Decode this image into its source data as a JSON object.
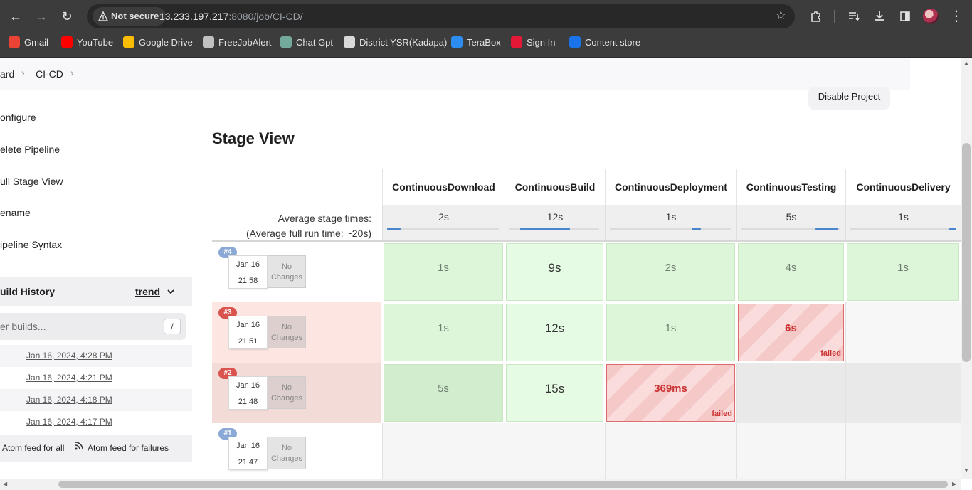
{
  "browser": {
    "back": "←",
    "forward": "→",
    "reload": "↻",
    "security_label": "Not secure",
    "url_host": "13.233.197.217",
    "url_rest": ":8080/job/CI-CD/",
    "star": "☆",
    "menu": "⋮"
  },
  "bookmarks": [
    {
      "label": "Gmail",
      "color": "#ea4335"
    },
    {
      "label": "YouTube",
      "color": "#ff0000"
    },
    {
      "label": "Google Drive",
      "color": "#fbbc04"
    },
    {
      "label": "FreeJobAlert",
      "color": "#c0c0c0"
    },
    {
      "label": "Chat Gpt",
      "color": "#74aa9c"
    },
    {
      "label": "District YSR(Kadapa)",
      "color": "#d9d9d9"
    },
    {
      "label": "TeraBox",
      "color": "#2d8cf0"
    },
    {
      "label": "Sign In",
      "color": "#e31837"
    },
    {
      "label": "Content store",
      "color": "#1a73e8"
    }
  ],
  "breadcrumb": {
    "item1": "ard",
    "item2": "CI-CD",
    "sep": "›"
  },
  "disable_button": "Disable Project",
  "sidebar": {
    "links": [
      "onfigure",
      "elete Pipeline",
      "ull Stage View",
      "ename",
      "ipeline Syntax"
    ],
    "build_history": "uild History",
    "trend": "trend",
    "filter_placeholder": "er builds...",
    "slash": "/",
    "builds": [
      "Jan 16, 2024, 4:28 PM",
      "Jan 16, 2024, 4:21 PM",
      "Jan 16, 2024, 4:18 PM",
      "Jan 16, 2024, 4:17 PM"
    ],
    "atom_all": "Atom feed for all",
    "atom_failures": "Atom feed for failures"
  },
  "stage_view": {
    "title": "Stage View",
    "avg_label_1": "Average stage times:",
    "avg_label_2_pre": "(Average ",
    "avg_label_2_link": "full",
    "avg_label_2_post": " run time: ~20s)",
    "stages": [
      {
        "name": "ContinuousDownload",
        "avg": "2s",
        "avg_fraction": 0.12
      },
      {
        "name": "ContinuousBuild",
        "avg": "12s",
        "avg_fraction": 0.55
      },
      {
        "name": "ContinuousDeployment",
        "avg": "1s",
        "avg_fraction": 0.08
      },
      {
        "name": "ContinuousTesting",
        "avg": "5s",
        "avg_fraction": 0.23
      },
      {
        "name": "ContinuousDelivery",
        "avg": "1s",
        "avg_fraction": 0.06
      }
    ],
    "no_changes": "No Changes",
    "failed_label": "failed",
    "runs": [
      {
        "badge": "#4",
        "date": "Jan 16",
        "time": "21:58",
        "status": "success",
        "cells": [
          "1s",
          "9s",
          "2s",
          "4s",
          "1s"
        ]
      },
      {
        "badge": "#3",
        "date": "Jan 16",
        "time": "21:51",
        "status": "failed",
        "cells": [
          "1s",
          "12s",
          "1s",
          "6s",
          ""
        ]
      },
      {
        "badge": "#2",
        "date": "Jan 16",
        "time": "21:48",
        "status": "failed",
        "cells": [
          "5s",
          "15s",
          "369ms",
          "",
          ""
        ]
      },
      {
        "badge": "#1",
        "date": "Jan 16",
        "time": "21:47",
        "status": "unknown",
        "cells": [
          "",
          "",
          "",
          "",
          ""
        ]
      }
    ]
  },
  "colors": {
    "success_cell": "#ddf5d9",
    "fail_badge": "#d9534f",
    "ok_badge": "#8aa9d6",
    "fail_row": "#fbe3e0"
  }
}
